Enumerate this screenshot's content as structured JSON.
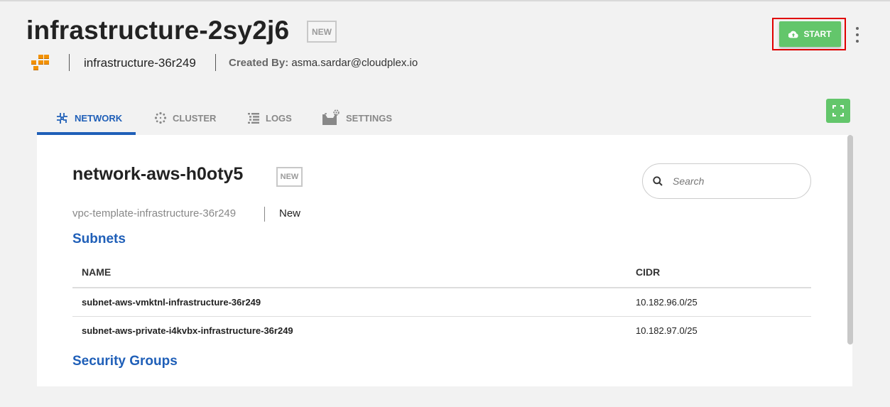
{
  "header": {
    "title": "infrastructure-2sy2j6",
    "badge": "NEW",
    "parent_name": "infrastructure-36r249",
    "created_by_label": "Created By:",
    "created_by_value": "asma.sardar@cloudplex.io",
    "start_label": "START"
  },
  "tabs": [
    {
      "label": "NETWORK",
      "icon": "network-icon",
      "active": true
    },
    {
      "label": "CLUSTER",
      "icon": "cluster-icon",
      "active": false
    },
    {
      "label": "LOGS",
      "icon": "logs-icon",
      "active": false
    },
    {
      "label": "SETTINGS",
      "icon": "settings-icon",
      "active": false
    }
  ],
  "network": {
    "title": "network-aws-h0oty5",
    "badge": "NEW",
    "vpc": "vpc-template-infrastructure-36r249",
    "status": "New",
    "search_placeholder": "Search"
  },
  "subnets": {
    "heading": "Subnets",
    "columns": [
      "NAME",
      "CIDR"
    ],
    "rows": [
      {
        "name": "subnet-aws-vmktnl-infrastructure-36r249",
        "cidr": "10.182.96.0/25"
      },
      {
        "name": "subnet-aws-private-i4kvbx-infrastructure-36r249",
        "cidr": "10.182.97.0/25"
      }
    ]
  },
  "security_groups": {
    "heading": "Security Groups"
  },
  "colors": {
    "accent": "#1f5fb8",
    "start_button": "#63c66b",
    "highlight": "#e00000",
    "aws_orange": "#f29100"
  }
}
